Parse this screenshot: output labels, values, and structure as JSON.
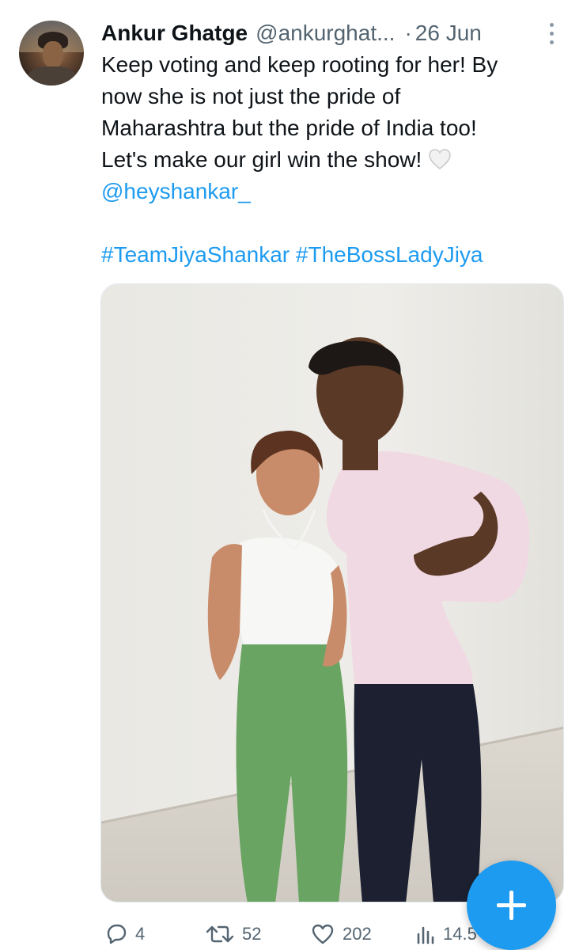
{
  "tweet": {
    "author_name": "Ankur Ghatge",
    "author_handle": "@ankurghat...",
    "separator": "·",
    "date": "26 Jun",
    "text_lines": [
      "Keep voting and keep rooting for her! By",
      "now she is not just the pride of",
      "Maharashtra but the pride of India too!",
      "Let's make our girl win the show!"
    ],
    "mention": "@heyshankar_",
    "hashtags": [
      "#TeamJiyaShankar",
      "#TheBossLadyJiya"
    ],
    "emoji": "white-heart-emoji"
  },
  "actions": {
    "replies": "4",
    "retweets": "52",
    "likes": "202",
    "views": "14.5"
  },
  "icons": [
    "more-vertical-icon",
    "reply-icon",
    "retweet-icon",
    "like-icon",
    "views-icon",
    "compose-plus-icon"
  ],
  "colors": {
    "accent": "#1d9bf0",
    "text": "#0f1419",
    "secondary": "#536471"
  }
}
